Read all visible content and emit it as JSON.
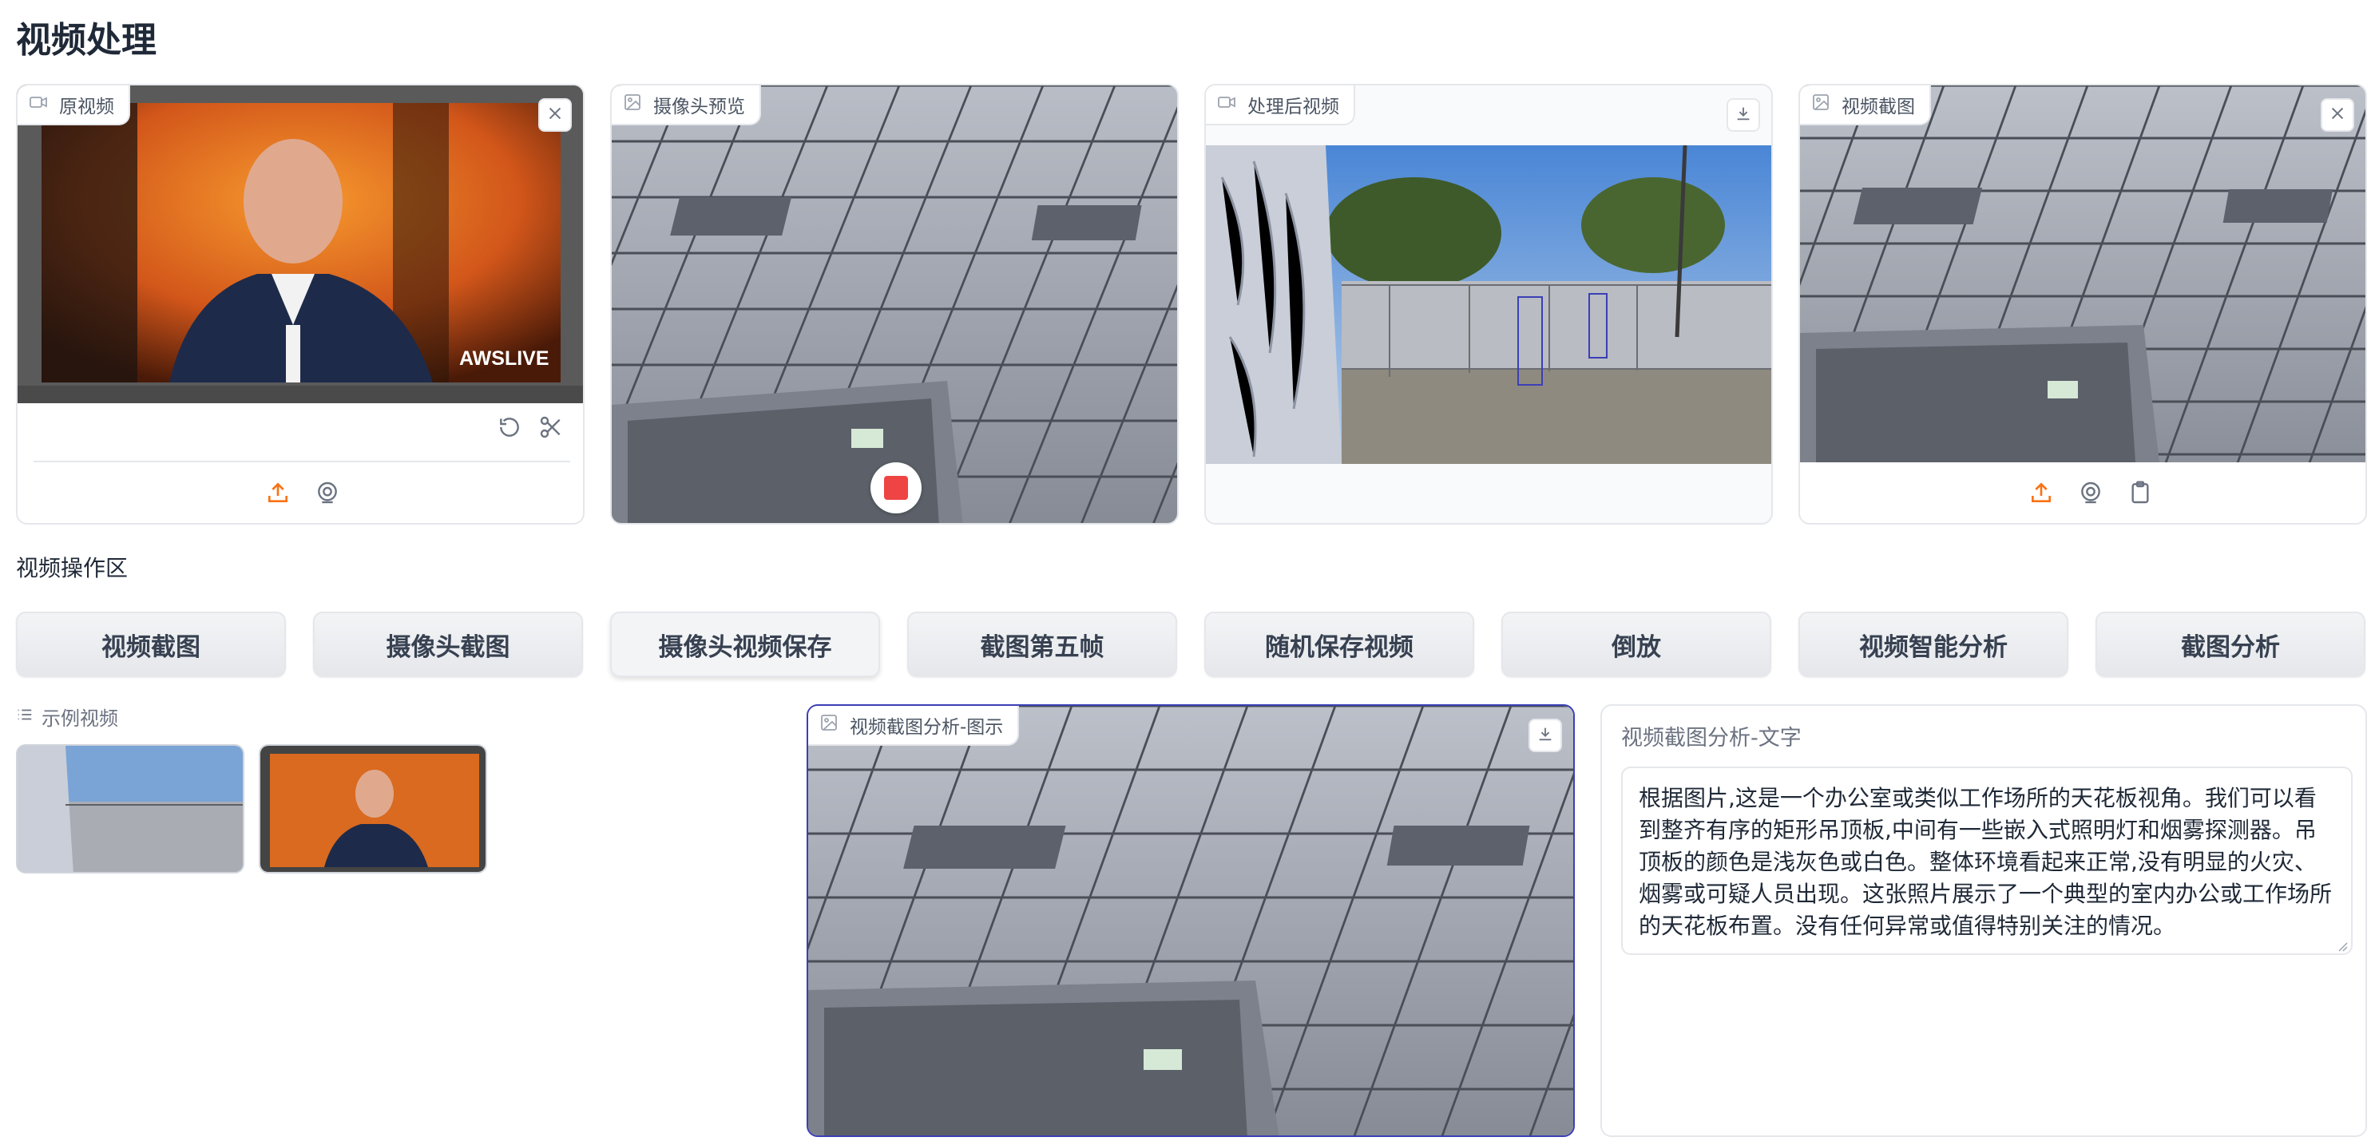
{
  "page": {
    "title": "视频处理"
  },
  "panels": {
    "original_video": {
      "label": "原视频"
    },
    "camera_preview": {
      "label": "摄像头预览"
    },
    "processed_video": {
      "label": "处理后视频"
    },
    "video_screenshot": {
      "label": "视频截图"
    },
    "screenshot_analysis_image": {
      "label": "视频截图分析-图示"
    },
    "screenshot_analysis_text": {
      "label": "视频截图分析-文字",
      "value": "根据图片,这是一个办公室或类似工作场所的天花板视角。我们可以看到整齐有序的矩形吊顶板,中间有一些嵌入式照明灯和烟雾探测器。吊顶板的颜色是浅灰色或白色。整体环境看起来正常,没有明显的火灾、烟雾或可疑人员出现。这张照片展示了一个典型的室内办公或工作场所的天花板布置。没有任何异常或值得特别关注的情况。"
    }
  },
  "overlays": {
    "aws_live": "AWSLIVE"
  },
  "section": {
    "operations_label": "视频操作区"
  },
  "buttons": {
    "video_screenshot": "视频截图",
    "camera_screenshot": "摄像头截图",
    "camera_video_save": "摄像头视频保存",
    "screenshot_fifth_frame": "截图第五帧",
    "random_save_video": "随机保存视频",
    "reverse": "倒放",
    "video_smart_analysis": "视频智能分析",
    "screenshot_analysis": "截图分析"
  },
  "examples": {
    "label": "示例视频"
  },
  "colors": {
    "accent": "#f97316",
    "record_red": "#ef4444",
    "focus_border": "#3b3fb6"
  }
}
